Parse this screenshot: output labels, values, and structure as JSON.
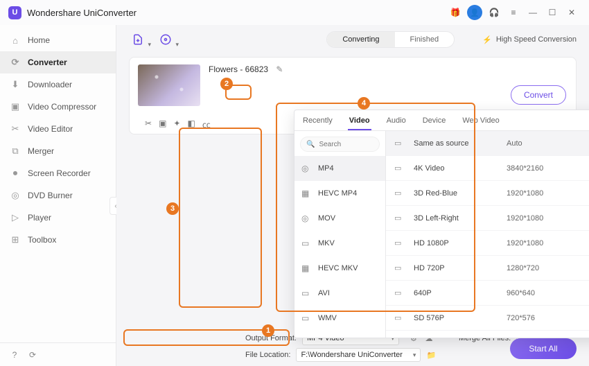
{
  "app_title": "Wondershare UniConverter",
  "titlebar_icons": [
    "gift-icon",
    "avatar",
    "headset-icon",
    "menu-icon",
    "minimize-icon",
    "maximize-icon",
    "close-icon"
  ],
  "sidebar": {
    "items": [
      {
        "icon": "⌂",
        "label": "Home",
        "name": "home"
      },
      {
        "icon": "⟳",
        "label": "Converter",
        "name": "converter",
        "active": true
      },
      {
        "icon": "⬇",
        "label": "Downloader",
        "name": "downloader"
      },
      {
        "icon": "▣",
        "label": "Video Compressor",
        "name": "video-compressor"
      },
      {
        "icon": "✂",
        "label": "Video Editor",
        "name": "video-editor"
      },
      {
        "icon": "⧉",
        "label": "Merger",
        "name": "merger"
      },
      {
        "icon": "⏺",
        "label": "Screen Recorder",
        "name": "screen-recorder"
      },
      {
        "icon": "◎",
        "label": "DVD Burner",
        "name": "dvd-burner"
      },
      {
        "icon": "▷",
        "label": "Player",
        "name": "player"
      },
      {
        "icon": "⊞",
        "label": "Toolbox",
        "name": "toolbox"
      }
    ]
  },
  "toolbar": {
    "tabs": {
      "converting": "Converting",
      "finished": "Finished",
      "active": "converting"
    },
    "high_speed": "High Speed Conversion"
  },
  "file": {
    "title": "Flowers - 66823",
    "convert": "Convert"
  },
  "dropdown": {
    "tabs": [
      {
        "label": "Recently",
        "name": "recently"
      },
      {
        "label": "Video",
        "name": "video",
        "active": true
      },
      {
        "label": "Audio",
        "name": "audio"
      },
      {
        "label": "Device",
        "name": "device"
      },
      {
        "label": "Web Video",
        "name": "web-video"
      }
    ],
    "search_placeholder": "Search",
    "formats": [
      {
        "icon": "◎",
        "label": "MP4",
        "active": true
      },
      {
        "icon": "▦",
        "label": "HEVC MP4"
      },
      {
        "icon": "◎",
        "label": "MOV"
      },
      {
        "icon": "▭",
        "label": "MKV"
      },
      {
        "icon": "▦",
        "label": "HEVC MKV"
      },
      {
        "icon": "▭",
        "label": "AVI"
      },
      {
        "icon": "▭",
        "label": "WMV"
      }
    ],
    "resolutions": [
      {
        "name": "Same as source",
        "res": "Auto",
        "active": true
      },
      {
        "name": "4K Video",
        "res": "3840*2160"
      },
      {
        "name": "3D Red-Blue",
        "res": "1920*1080"
      },
      {
        "name": "3D Left-Right",
        "res": "1920*1080"
      },
      {
        "name": "HD 1080P",
        "res": "1920*1080"
      },
      {
        "name": "HD 720P",
        "res": "1280*720"
      },
      {
        "name": "640P",
        "res": "960*640"
      },
      {
        "name": "SD 576P",
        "res": "720*576"
      }
    ]
  },
  "footer": {
    "output_format_label": "Output Format:",
    "output_format_value": "MP4 Video",
    "file_location_label": "File Location:",
    "file_location_value": "F:\\Wondershare UniConverter",
    "merge_label": "Merge All Files:",
    "start_all": "Start All"
  },
  "callouts": {
    "1": "1",
    "2": "2",
    "3": "3",
    "4": "4"
  }
}
